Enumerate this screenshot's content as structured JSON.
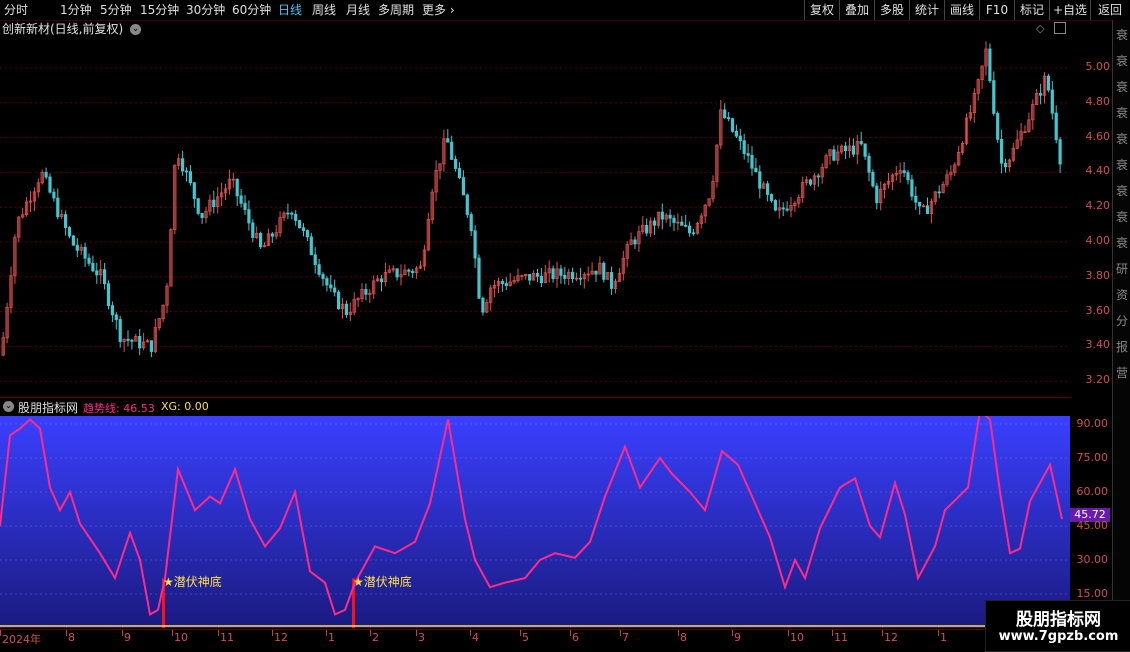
{
  "toolbar": {
    "periods": [
      "分时",
      "1分钟",
      "5分钟",
      "15分钟",
      "30分钟",
      "60分钟",
      "日线",
      "周线",
      "月线",
      "多周期",
      "更多"
    ],
    "active": "日线",
    "right_buttons": [
      "复权",
      "叠加",
      "多股",
      "统计",
      "画线",
      "F10",
      "标记",
      "+自选",
      "返回"
    ]
  },
  "chart_title": "创新新材(日线,前复权)",
  "main_yaxis": [
    "5.00",
    "4.80",
    "4.60",
    "4.40",
    "4.20",
    "4.00",
    "3.80",
    "3.60",
    "3.40",
    "3.20"
  ],
  "indicator": {
    "name": "股朋指标网",
    "trend_label": "趋势线: 46.53",
    "xg_label": "XG: 0.00",
    "current_value": "45.72",
    "yaxis": [
      "90.00",
      "75.00",
      "60.00",
      "45.00",
      "30.00",
      "15.00"
    ],
    "signals": [
      {
        "label": "★潜伏神底"
      },
      {
        "label": "★潜伏神底"
      }
    ]
  },
  "xaxis": [
    "2024年",
    "8",
    "9",
    "10",
    "11",
    "12",
    "1",
    "2",
    "3",
    "4",
    "5",
    "6",
    "7",
    "8",
    "9",
    "10",
    "11",
    "12",
    "1"
  ],
  "right_strip": [
    "衰",
    "衰",
    "衰",
    "衰",
    "衰",
    "衰",
    "衰",
    "衰",
    "衰",
    "研",
    "资",
    "分",
    "报",
    "营"
  ],
  "watermark": {
    "title": "股朋指标网",
    "url": "www.7gpzb.com"
  },
  "colors": {
    "up": "#e05050",
    "down": "#40c8d0",
    "trend": "#ff2a8a",
    "signal": "#ff1010",
    "label": "#ffe040",
    "grid": "#5a0000"
  }
}
